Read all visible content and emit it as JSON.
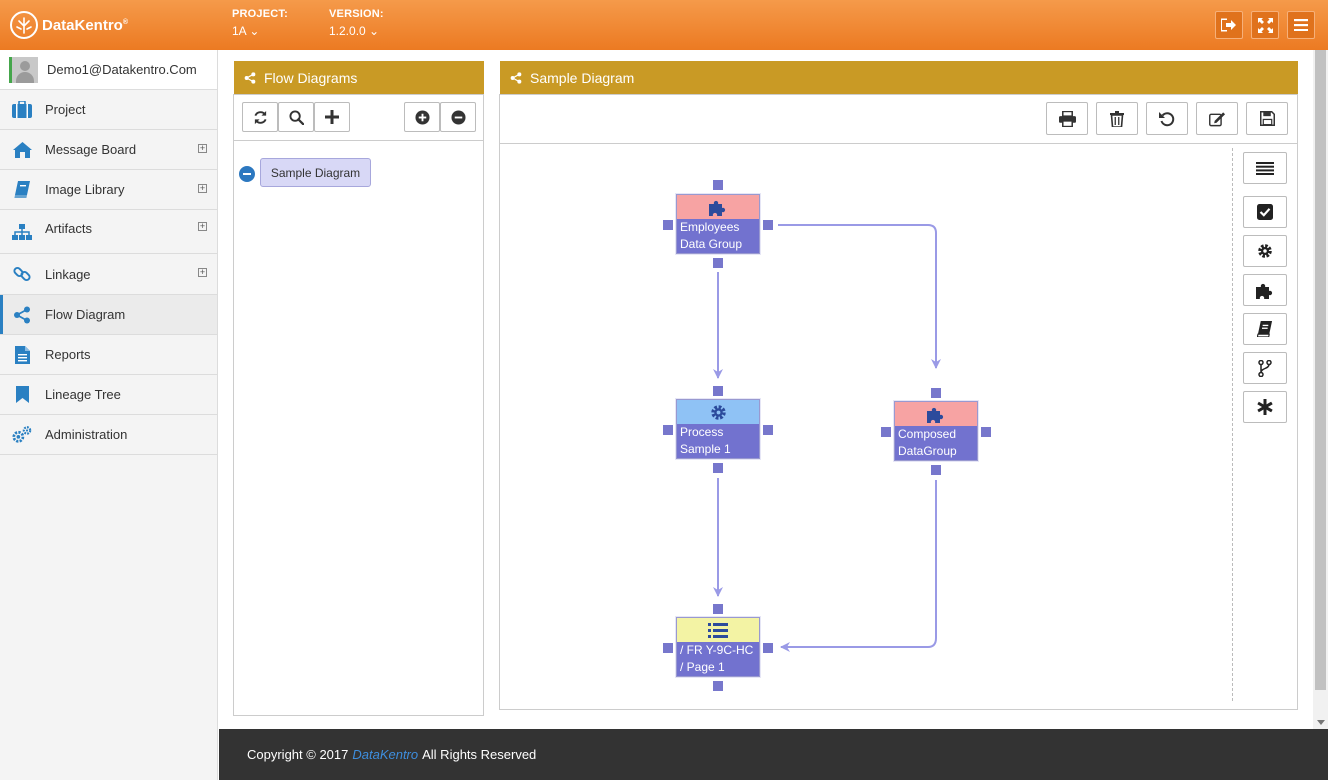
{
  "header": {
    "logo_text": "DataKentro",
    "logo_reg": "®",
    "project_label": "PROJECT:",
    "project_value": "1A ⌄",
    "version_label": "VERSION:",
    "version_value": "1.2.0.0 ⌄",
    "buttons": [
      "logout-icon",
      "fullscreen-icon",
      "menu-icon"
    ]
  },
  "sidebar": {
    "user": "Demo1@Datakentro.Com",
    "items": [
      {
        "label": "Project",
        "icon": "briefcase-icon",
        "expandable": false
      },
      {
        "label": "Message Board",
        "icon": "home-icon",
        "expandable": true
      },
      {
        "label": "Image Library",
        "icon": "book-icon",
        "expandable": true
      },
      {
        "label": "Artifacts",
        "icon": "sitemap-icon",
        "expandable": true
      },
      {
        "label": "Linkage",
        "icon": "link-icon",
        "expandable": true
      },
      {
        "label": "Flow Diagram",
        "icon": "share-icon",
        "expandable": false,
        "active": true
      },
      {
        "label": "Reports",
        "icon": "file-text-icon",
        "expandable": false
      },
      {
        "label": "Lineage Tree",
        "icon": "bookmark-icon",
        "expandable": false
      },
      {
        "label": "Administration",
        "icon": "cogs-icon",
        "expandable": false
      }
    ],
    "expand_symbol": "+"
  },
  "flow_panel": {
    "title": "Flow Diagrams",
    "toolbar": [
      "refresh-icon",
      "search-icon",
      "plus-icon",
      "plus-circle-icon",
      "minus-circle-icon"
    ],
    "tree_node": "Sample Diagram"
  },
  "diagram_panel": {
    "title": "Sample Diagram",
    "toolbar": [
      "print-icon",
      "trash-icon",
      "undo-icon",
      "edit-icon",
      "save-icon"
    ],
    "side_tools": [
      "list-icon",
      "check-square-icon",
      "gear-icon",
      "puzzle-icon",
      "book-icon",
      "branch-icon",
      "asterisk-icon"
    ],
    "nodes": {
      "employees": {
        "line1": "Employees",
        "line2": "Data Group",
        "icon": "puzzle-icon",
        "top_color": "#f7a3a3"
      },
      "process": {
        "line1": "Process",
        "line2": "Sample 1",
        "icon": "gear-icon",
        "top_color": "#8fc2f5"
      },
      "composed": {
        "line1": "Composed",
        "line2": "DataGroup",
        "icon": "puzzle-icon",
        "top_color": "#f7a3a3"
      },
      "report": {
        "line1": "/ FR Y-9C-HC",
        "line2": "/ Page 1",
        "icon": "list-icon",
        "top_color": "#f3f3a4"
      }
    },
    "edges": [
      {
        "from": "employees",
        "to": "process"
      },
      {
        "from": "employees",
        "to": "composed"
      },
      {
        "from": "process",
        "to": "report"
      },
      {
        "from": "composed",
        "to": "report"
      }
    ],
    "colors": {
      "node_body": "#7272cf",
      "edge": "#9a9ae6",
      "header_bar": "#c99a25"
    }
  },
  "footer": {
    "prefix": "Copyright © 2017",
    "brand": "DataKentro",
    "suffix": "All Rights Reserved"
  }
}
